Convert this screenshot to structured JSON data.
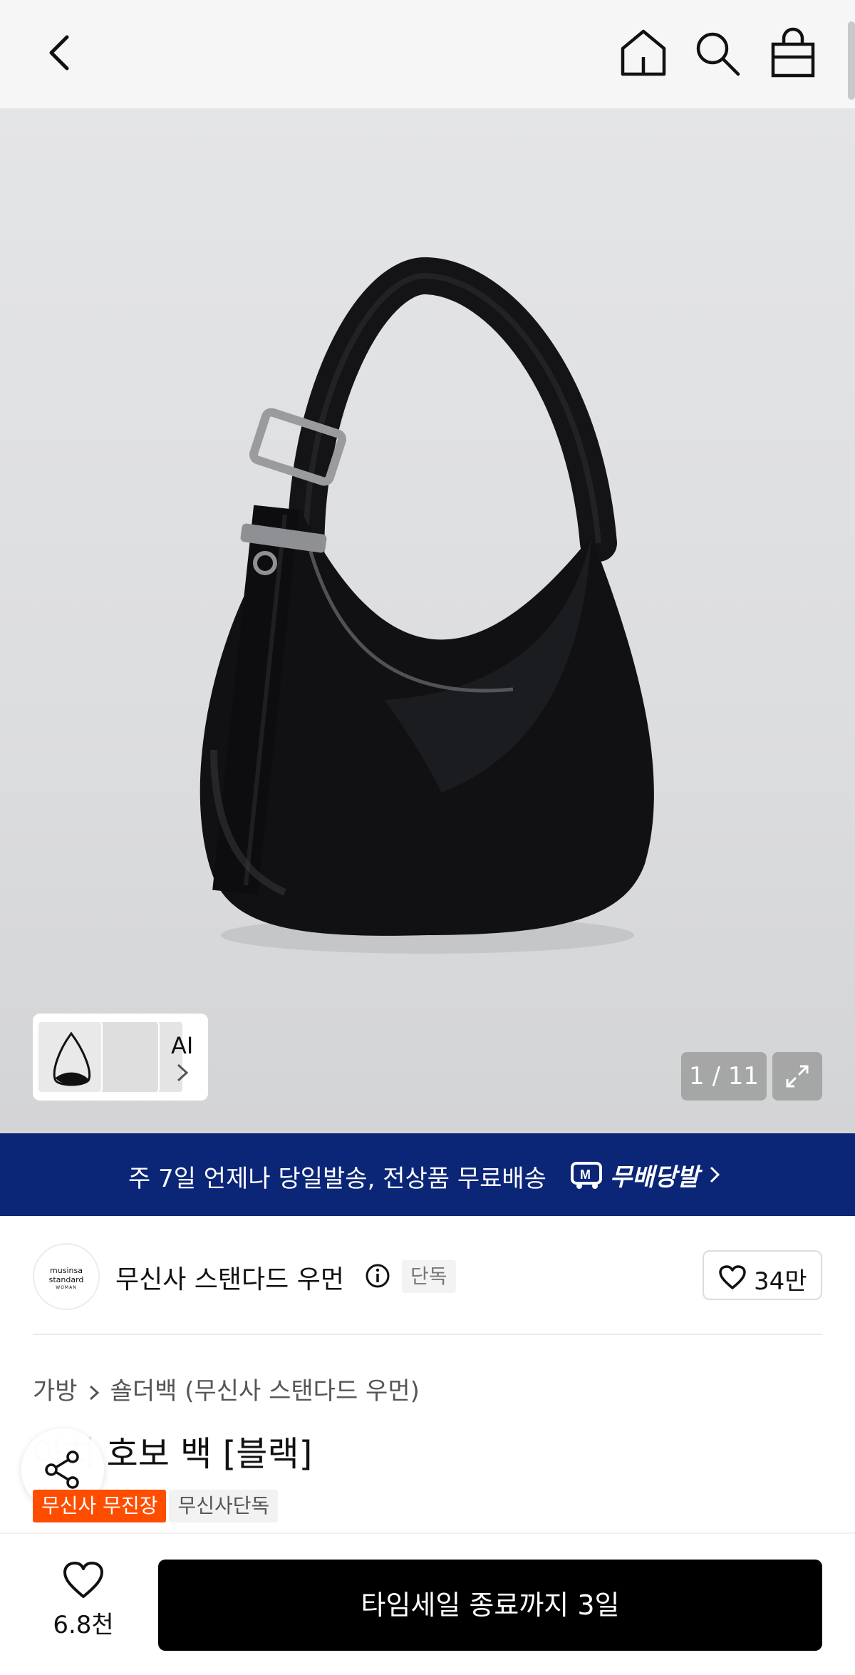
{
  "header": {
    "back_icon": "chevron-left-icon",
    "home_icon": "home-icon",
    "search_icon": "search-icon",
    "cart_icon": "shopping-bag-icon"
  },
  "gallery": {
    "ai_label": "AI",
    "counter": "1 / 11",
    "expand_icon": "expand-icon"
  },
  "banner": {
    "text": "주 7일 언제나 당일발송, 전상품 무료배송",
    "brand": "무배당발",
    "bg_color": "#0b2677"
  },
  "brand": {
    "logo_line1": "musinsa",
    "logo_line2": "standard",
    "logo_line3": "WOMAN",
    "name": "무신사 스탠다드 우먼",
    "tag": "단독",
    "likes": "34만"
  },
  "product": {
    "category": "가방",
    "subcategory": "숄더백 (무신사 스탠다드 우먼)",
    "title_hidden": "아치",
    "title": " 호보 백 [블랙]",
    "badges": [
      "무신사 무진장",
      "무신사단독"
    ],
    "badge_color": "#ff4d00"
  },
  "bottom": {
    "wish_count": "6.8천",
    "cta": "타임세일 종료까지 3일"
  }
}
